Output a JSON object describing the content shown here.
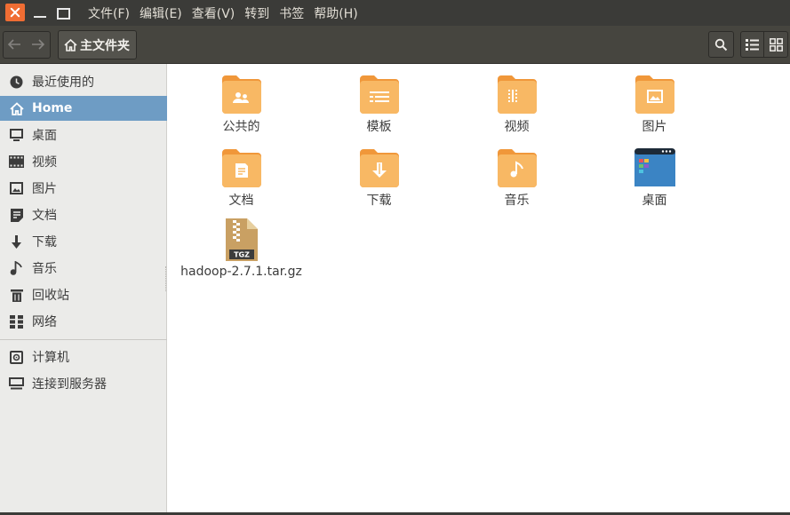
{
  "menubar": {
    "items": [
      "文件(F)",
      "编辑(E)",
      "查看(V)",
      "转到",
      "书签",
      "帮助(H)"
    ]
  },
  "toolbar": {
    "breadcrumb_label": "主文件夹"
  },
  "sidebar": {
    "items": [
      {
        "label": "最近使用的",
        "icon": "clock-icon"
      },
      {
        "label": "Home",
        "icon": "home-icon",
        "active": true
      },
      {
        "label": "桌面",
        "icon": "desktop-icon"
      },
      {
        "label": "视频",
        "icon": "video-icon"
      },
      {
        "label": "图片",
        "icon": "pictures-icon"
      },
      {
        "label": "文档",
        "icon": "document-icon"
      },
      {
        "label": "下载",
        "icon": "download-icon"
      },
      {
        "label": "音乐",
        "icon": "music-icon"
      },
      {
        "label": "回收站",
        "icon": "trash-icon"
      },
      {
        "label": "网络",
        "icon": "network-icon"
      },
      {
        "label": "计算机",
        "icon": "computer-icon"
      },
      {
        "label": "连接到服务器",
        "icon": "server-icon"
      }
    ]
  },
  "files": [
    {
      "label": "公共的",
      "icon": "public-folder-icon"
    },
    {
      "label": "模板",
      "icon": "templates-folder-icon"
    },
    {
      "label": "视频",
      "icon": "videos-folder-icon"
    },
    {
      "label": "图片",
      "icon": "pictures-folder-icon"
    },
    {
      "label": "文档",
      "icon": "documents-folder-icon"
    },
    {
      "label": "下载",
      "icon": "downloads-folder-icon"
    },
    {
      "label": "音乐",
      "icon": "music-folder-icon"
    },
    {
      "label": "桌面",
      "icon": "desktop-folder-icon"
    },
    {
      "label": "hadoop-2.7.1.tar.gz",
      "icon": "archive-file-icon",
      "badge": "TGZ"
    }
  ],
  "colors": {
    "accent": "#6e9cc4",
    "folder": "#f5a94a",
    "close_button": "#f06d33"
  }
}
